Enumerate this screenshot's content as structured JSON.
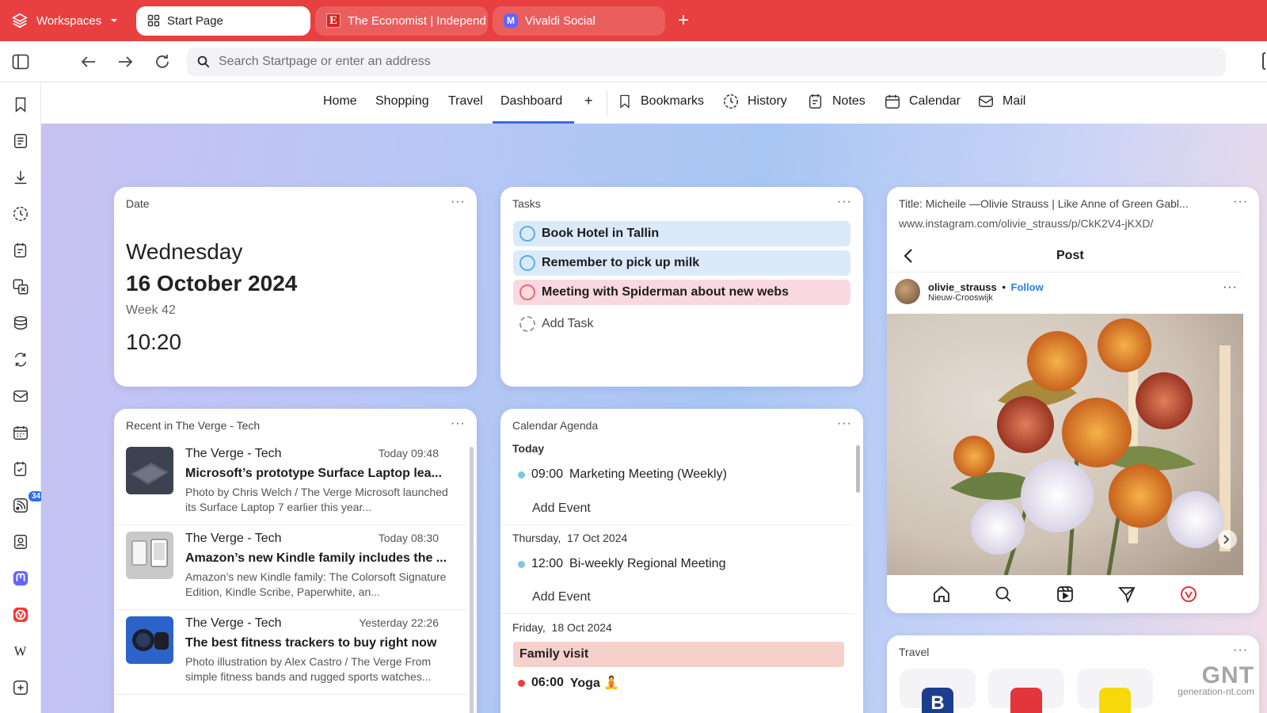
{
  "tabbar": {
    "workspaces_label": "Workspaces",
    "tabs": [
      {
        "title": "Start Page"
      },
      {
        "title": "The Economist | Independ",
        "favicon_letter": "E"
      },
      {
        "title": "Vivaldi Social",
        "favicon_letter": "M"
      }
    ],
    "new_tab_label": "+",
    "accent_color": "#e84040"
  },
  "address": {
    "placeholder": "Search Startpage or enter an address"
  },
  "sidepanel": {
    "feed_badge": "34"
  },
  "dashboard_nav": {
    "pages": [
      "Home",
      "Shopping",
      "Travel",
      "Dashboard"
    ],
    "active": "Dashboard",
    "add_label": "+",
    "panels": [
      "Bookmarks",
      "History",
      "Notes",
      "Calendar",
      "Mail"
    ]
  },
  "date_widget": {
    "title": "Date",
    "weekday": "Wednesday",
    "date": "16 October 2024",
    "week": "Week 42",
    "time": "10:20"
  },
  "tasks_widget": {
    "title": "Tasks",
    "tasks": [
      "Book Hotel in Tallin",
      "Remember to pick up milk",
      "Meeting with Spiderman about new webs"
    ],
    "add_label": "Add Task"
  },
  "instagram_widget": {
    "title": "Title: Micheile —Olivie Strauss | Like Anne of Green Gabl...",
    "url": "www.instagram.com/olivie_strauss/p/CkK2V4-jKXD/",
    "post_label": "Post",
    "username": "olivie_strauss",
    "separator": "•",
    "follow_label": "Follow",
    "location": "Nieuw-Crooswijk"
  },
  "news_widget": {
    "title": "Recent in The Verge - Tech",
    "items": [
      {
        "source": "The Verge - Tech",
        "time": "Today 09:48",
        "headline": "Microsoft’s prototype Surface Laptop lea...",
        "desc": "Photo by Chris Welch / The Verge Microsoft launched its Surface Laptop 7 earlier this year..."
      },
      {
        "source": "The Verge - Tech",
        "time": "Today 08:30",
        "headline": "Amazon’s new Kindle family includes the ...",
        "desc": "Amazon’s new Kindle family: The Colorsoft Signature Edition, Kindle Scribe, Paperwhite, an..."
      },
      {
        "source": "The Verge - Tech",
        "time": "Yesterday 22:26",
        "headline": "The best fitness trackers to buy right now",
        "desc": "Photo illustration by Alex Castro / The Verge From simple fitness bands and rugged sports watches..."
      }
    ]
  },
  "calendar_widget": {
    "title": "Calendar Agenda",
    "today_label": "Today",
    "day1_event_time": "09:00",
    "day1_event": "Marketing Meeting (Weekly)",
    "add_event_label": "Add Event",
    "day2_weekday": "Thursday,",
    "day2_date": "17 Oct 2024",
    "day2_event_time": "12:00",
    "day2_event": "Bi-weekly Regional Meeting",
    "day3_weekday": "Friday,",
    "day3_date": "18 Oct 2024",
    "day3_allday_event": "Family visit",
    "day3_event_time": "06:00",
    "day3_event": "Yoga 🧘"
  },
  "travel_widget": {
    "title": "Travel"
  },
  "watermark": {
    "logo": "GNT",
    "site": "generation-nt.com"
  }
}
